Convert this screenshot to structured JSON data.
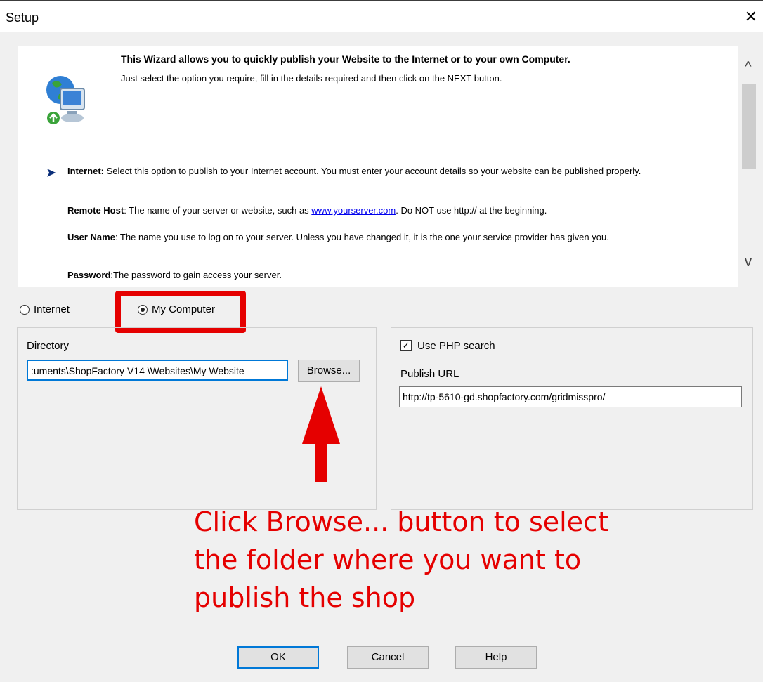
{
  "window": {
    "title": "Setup",
    "close_glyph": "✕"
  },
  "info": {
    "headline": "This Wizard allows you to quickly publish your Website to the Internet or to your own Computer.",
    "subline": "Just select the option you require, fill in the details required and then click on the NEXT button.",
    "bullet_glyph": "➤",
    "internet_label": "Internet:",
    "internet_text": " Select this option to publish to your Internet account. You must enter your account details so your website can be published properly.",
    "remote_host_label": "Remote Host",
    "remote_host_text_a": ": The name of your server or website, such as ",
    "remote_host_link": "www.yourserver.com",
    "remote_host_text_b": ". Do NOT use http:// at the beginning.",
    "user_name_label": "User Name",
    "user_name_text": ": The name you use to log on to your server. Unless you have changed it, it is the one your service provider has given you.",
    "password_label": "Password",
    "password_text": ":The password to gain access your server.",
    "scroll_up_glyph": "^",
    "scroll_down_glyph": "v"
  },
  "options": {
    "internet": "Internet",
    "my_computer": "My Computer",
    "selected": "My Computer"
  },
  "directory": {
    "label": "Directory",
    "value": ":uments\\ShopFactory V14 \\Websites\\My Website",
    "browse_label": "Browse..."
  },
  "php": {
    "checkbox_label": "Use PHP search",
    "checked": true,
    "check_glyph": "✓",
    "url_label": "Publish URL",
    "url_value": "http://tp-5610-gd.shopfactory.com/gridmisspro/"
  },
  "annotation": {
    "text": "Click Browse... button to select the folder where you want to publish the shop",
    "color": "#e50000"
  },
  "buttons": {
    "ok": "OK",
    "cancel": "Cancel",
    "help": "Help"
  }
}
